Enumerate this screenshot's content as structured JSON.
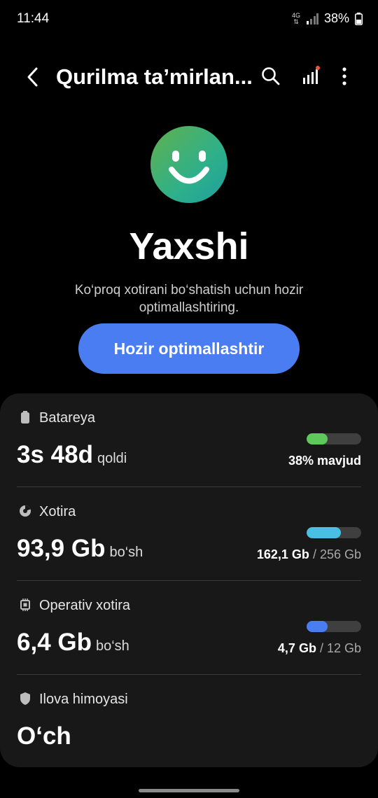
{
  "status_bar": {
    "time": "11:44",
    "network": "4G",
    "battery": "38%"
  },
  "header": {
    "title": "Qurilma ta’mirlan..."
  },
  "hero": {
    "status_word": "Yaxshi",
    "message": "Ko‘proq xotirani bo‘shatish uchun hozir optimallashtiring.",
    "button_label": "Hozir optimallashtir"
  },
  "items": [
    {
      "label": "Batareya",
      "value": "3s 48d",
      "unit": "qoldi",
      "right_bold": "38% mavjud",
      "right_dim": "",
      "fill_fraction": 0.38,
      "color": "#5ec95a",
      "icon": "battery-icon"
    },
    {
      "label": "Xotira",
      "value": "93,9 Gb",
      "unit": "bo‘sh",
      "right_bold": "162,1 Gb",
      "right_dim": " / 256 Gb",
      "fill_fraction": 0.633,
      "color": "#48bfe3",
      "icon": "storage-icon"
    },
    {
      "label": "Operativ xotira",
      "value": "6,4 Gb",
      "unit": "bo‘sh",
      "right_bold": "4,7 Gb",
      "right_dim": " / 12 Gb",
      "fill_fraction": 0.39,
      "color": "#4a7df1",
      "icon": "memory-chip-icon"
    },
    {
      "label": "Ilova himoyasi",
      "value": "O‘ch",
      "unit": "",
      "right_bold": "",
      "right_dim": "",
      "fill_fraction": null,
      "color": "",
      "icon": "shield-icon"
    }
  ]
}
